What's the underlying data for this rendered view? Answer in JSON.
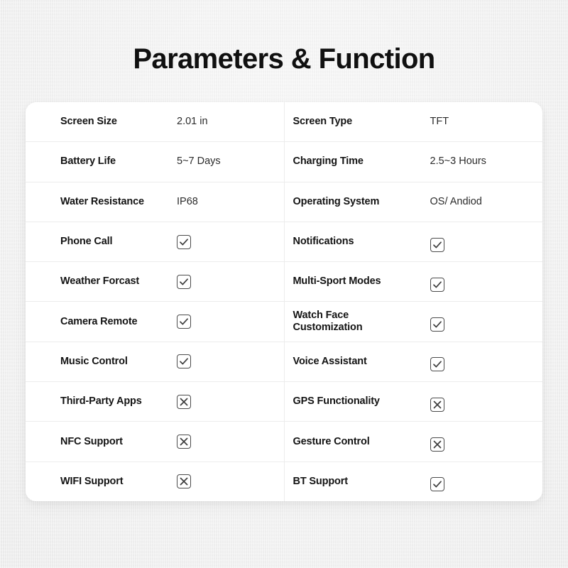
{
  "header": {
    "title": "Parameters & Function"
  },
  "spec_table": {
    "columns": 2,
    "rows": [
      {
        "left": {
          "label": "Screen Size",
          "value": "2.01 in",
          "type": "text"
        },
        "right": {
          "label": "Screen Type",
          "value": "TFT",
          "type": "text"
        }
      },
      {
        "left": {
          "label": "Battery Life",
          "value": "5~7 Days",
          "type": "text"
        },
        "right": {
          "label": "Charging Time",
          "value": "2.5~3 Hours",
          "type": "text"
        }
      },
      {
        "left": {
          "label": "Water Resistance",
          "value": "IP68",
          "type": "text"
        },
        "right": {
          "label": "Operating System",
          "value": "OS/ Andiod",
          "type": "text"
        }
      },
      {
        "left": {
          "label": "Phone Call",
          "value": "checked",
          "type": "mark",
          "icon": "checkbox-checked-icon"
        },
        "right": {
          "label": "Notifications",
          "value": "checked",
          "type": "mark",
          "icon": "checkbox-checked-icon"
        }
      },
      {
        "left": {
          "label": "Weather Forcast",
          "value": "checked",
          "type": "mark",
          "icon": "checkbox-checked-icon"
        },
        "right": {
          "label": "Multi-Sport Modes",
          "value": "checked",
          "type": "mark",
          "icon": "checkbox-checked-icon"
        }
      },
      {
        "left": {
          "label": "Camera Remote",
          "value": "checked",
          "type": "mark",
          "icon": "checkbox-checked-icon"
        },
        "right": {
          "label": "Watch Face Customization",
          "value": "checked",
          "type": "mark",
          "icon": "checkbox-checked-icon"
        }
      },
      {
        "left": {
          "label": "Music Control",
          "value": "checked",
          "type": "mark",
          "icon": "checkbox-checked-icon"
        },
        "right": {
          "label": "Voice Assistant",
          "value": "checked",
          "type": "mark",
          "icon": "checkbox-checked-icon"
        }
      },
      {
        "left": {
          "label": "Third-Party Apps",
          "value": "crossed",
          "type": "mark",
          "icon": "checkbox-crossed-icon"
        },
        "right": {
          "label": "GPS Functionality",
          "value": "crossed",
          "type": "mark",
          "icon": "checkbox-crossed-icon"
        }
      },
      {
        "left": {
          "label": "NFC Support",
          "value": "crossed",
          "type": "mark",
          "icon": "checkbox-crossed-icon"
        },
        "right": {
          "label": "Gesture Control",
          "value": "crossed",
          "type": "mark",
          "icon": "checkbox-crossed-icon"
        }
      },
      {
        "left": {
          "label": "WIFI Support",
          "value": "crossed",
          "type": "mark",
          "icon": "checkbox-crossed-icon"
        },
        "right": {
          "label": "BT Support",
          "value": "checked",
          "type": "mark",
          "icon": "checkbox-checked-icon"
        }
      }
    ]
  },
  "colors": {
    "page_background": "#f1f1f1",
    "card_background": "#ffffff",
    "title_text": "#101010",
    "label_text": "#141414",
    "value_text": "#2b2b2b",
    "divider": "#ececec",
    "mark_stroke": "#3d3d3d",
    "mark_border": "#4b4b4b"
  }
}
